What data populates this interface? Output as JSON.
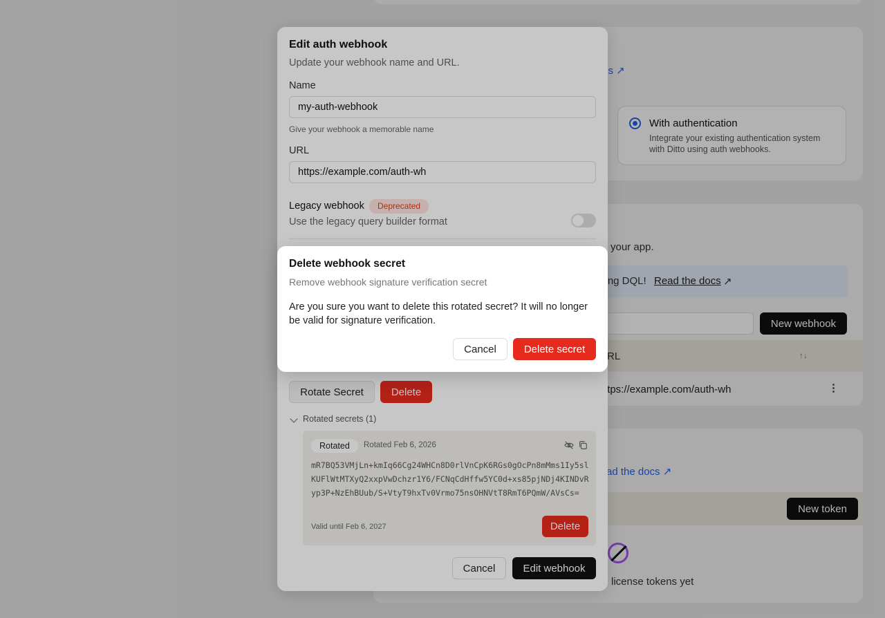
{
  "background": {
    "docs_link": "cs ↗",
    "auth_option": {
      "title": "With authentication",
      "description": "Integrate your existing authentication system with Ditto using auth webhooks."
    },
    "app_text": "your app.",
    "dql_text": "sing DQL!",
    "dql_link": "Read the docs",
    "dql_arrow": "↗",
    "new_webhook_button": "New webhook",
    "url_column_header": "RL",
    "sort_icon": "↑↓",
    "row_url": ":tps://example.com/auth-wh",
    "row_menu": "⋮",
    "tokens_docs_link": "ad the docs ↗",
    "new_token_button": "New token",
    "empty_tokens_text": "license tokens yet"
  },
  "edit_dialog": {
    "title": "Edit auth webhook",
    "subtitle": "Update your webhook name and URL.",
    "name_label": "Name",
    "name_value": "my-auth-webhook",
    "name_hint": "Give your webhook a memorable name",
    "url_label": "URL",
    "url_value": "https://example.com/auth-wh",
    "legacy_label": "Legacy webhook",
    "legacy_badge": "Deprecated",
    "legacy_description": "Use the legacy query builder format",
    "rotate_secret_button": "Rotate Secret",
    "delete_button": "Delete",
    "rotated_secrets_label": "Rotated secrets (1)",
    "rotated_secret": {
      "badge": "Rotated",
      "date": "Rotated Feb 6, 2026",
      "value": "mR7BQ53VMjLn+kmIq66Cg24WHCn8D0rlVnCpK6RGs0gOcPn8mMms1Iy5slKUFlWtMTXyQ2xxpVwDchzr1Y6/FCNqCdHffw5YC0d+xs85pjNDj4KINDvRyp3P+NzEhBUub/S+VtyT9hxTv0Vrmo75nsOHNVtT8RmT6PQmW/AVsCs=",
      "valid_until": "Valid until Feb 6, 2027",
      "delete_button": "Delete"
    },
    "cancel_button": "Cancel",
    "submit_button": "Edit webhook"
  },
  "delete_dialog": {
    "title": "Delete webhook secret",
    "subtitle": "Remove webhook signature verification secret",
    "body": "Are you sure you want to delete this rotated secret? It will no longer be valid for signature verification.",
    "cancel_button": "Cancel",
    "confirm_button": "Delete secret"
  },
  "colors": {
    "danger": "#e62b1e",
    "primary_dark": "#111111",
    "link": "#2563eb"
  }
}
